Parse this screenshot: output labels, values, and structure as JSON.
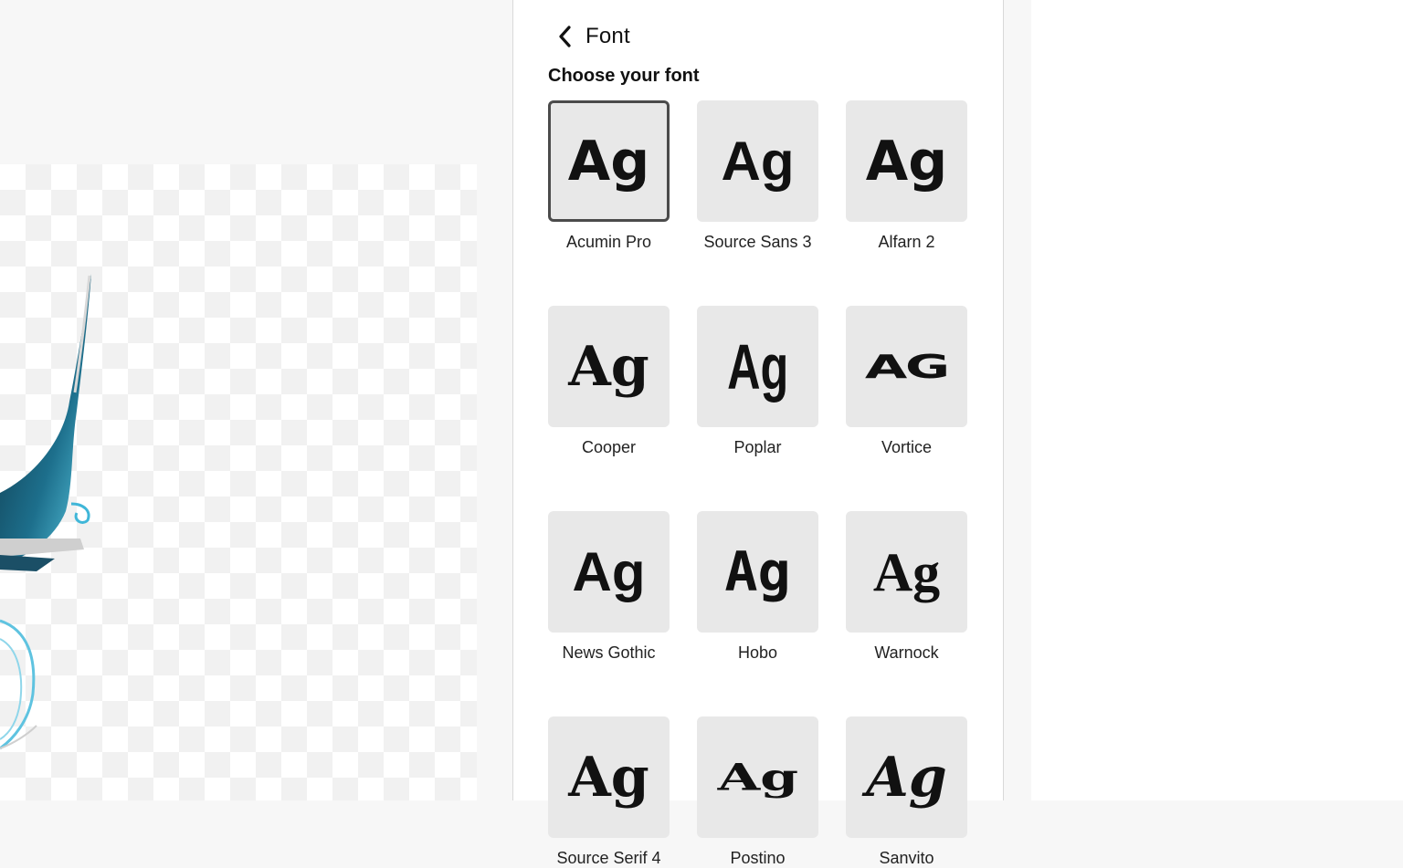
{
  "panel": {
    "title": "Font",
    "back_icon": "chevron-left-icon",
    "section_title": "Choose your font",
    "selected_font": "Acumin Pro",
    "fonts": [
      {
        "name": "Acumin Pro",
        "sample": "Ag",
        "selected": true
      },
      {
        "name": "Source Sans 3",
        "sample": "Ag"
      },
      {
        "name": "Alfarn 2",
        "sample": "Ag"
      },
      {
        "name": "Cooper",
        "sample": "Ag"
      },
      {
        "name": "Poplar",
        "sample": "Ag"
      },
      {
        "name": "Vortice",
        "sample": "AG"
      },
      {
        "name": "News Gothic",
        "sample": "Ag"
      },
      {
        "name": "Hobo",
        "sample": "Ag"
      },
      {
        "name": "Warnock",
        "sample": "Ag"
      },
      {
        "name": "Source Serif 4",
        "sample": "Ag"
      },
      {
        "name": "Postino",
        "sample": "Ag"
      },
      {
        "name": "Sanvito",
        "sample": "Ag"
      }
    ]
  },
  "colors": {
    "tile_background": "#e8e8e8",
    "selected_border": "#4b4b4b",
    "panel_background": "#ffffff",
    "canvas_background": "#f7f7f7"
  }
}
